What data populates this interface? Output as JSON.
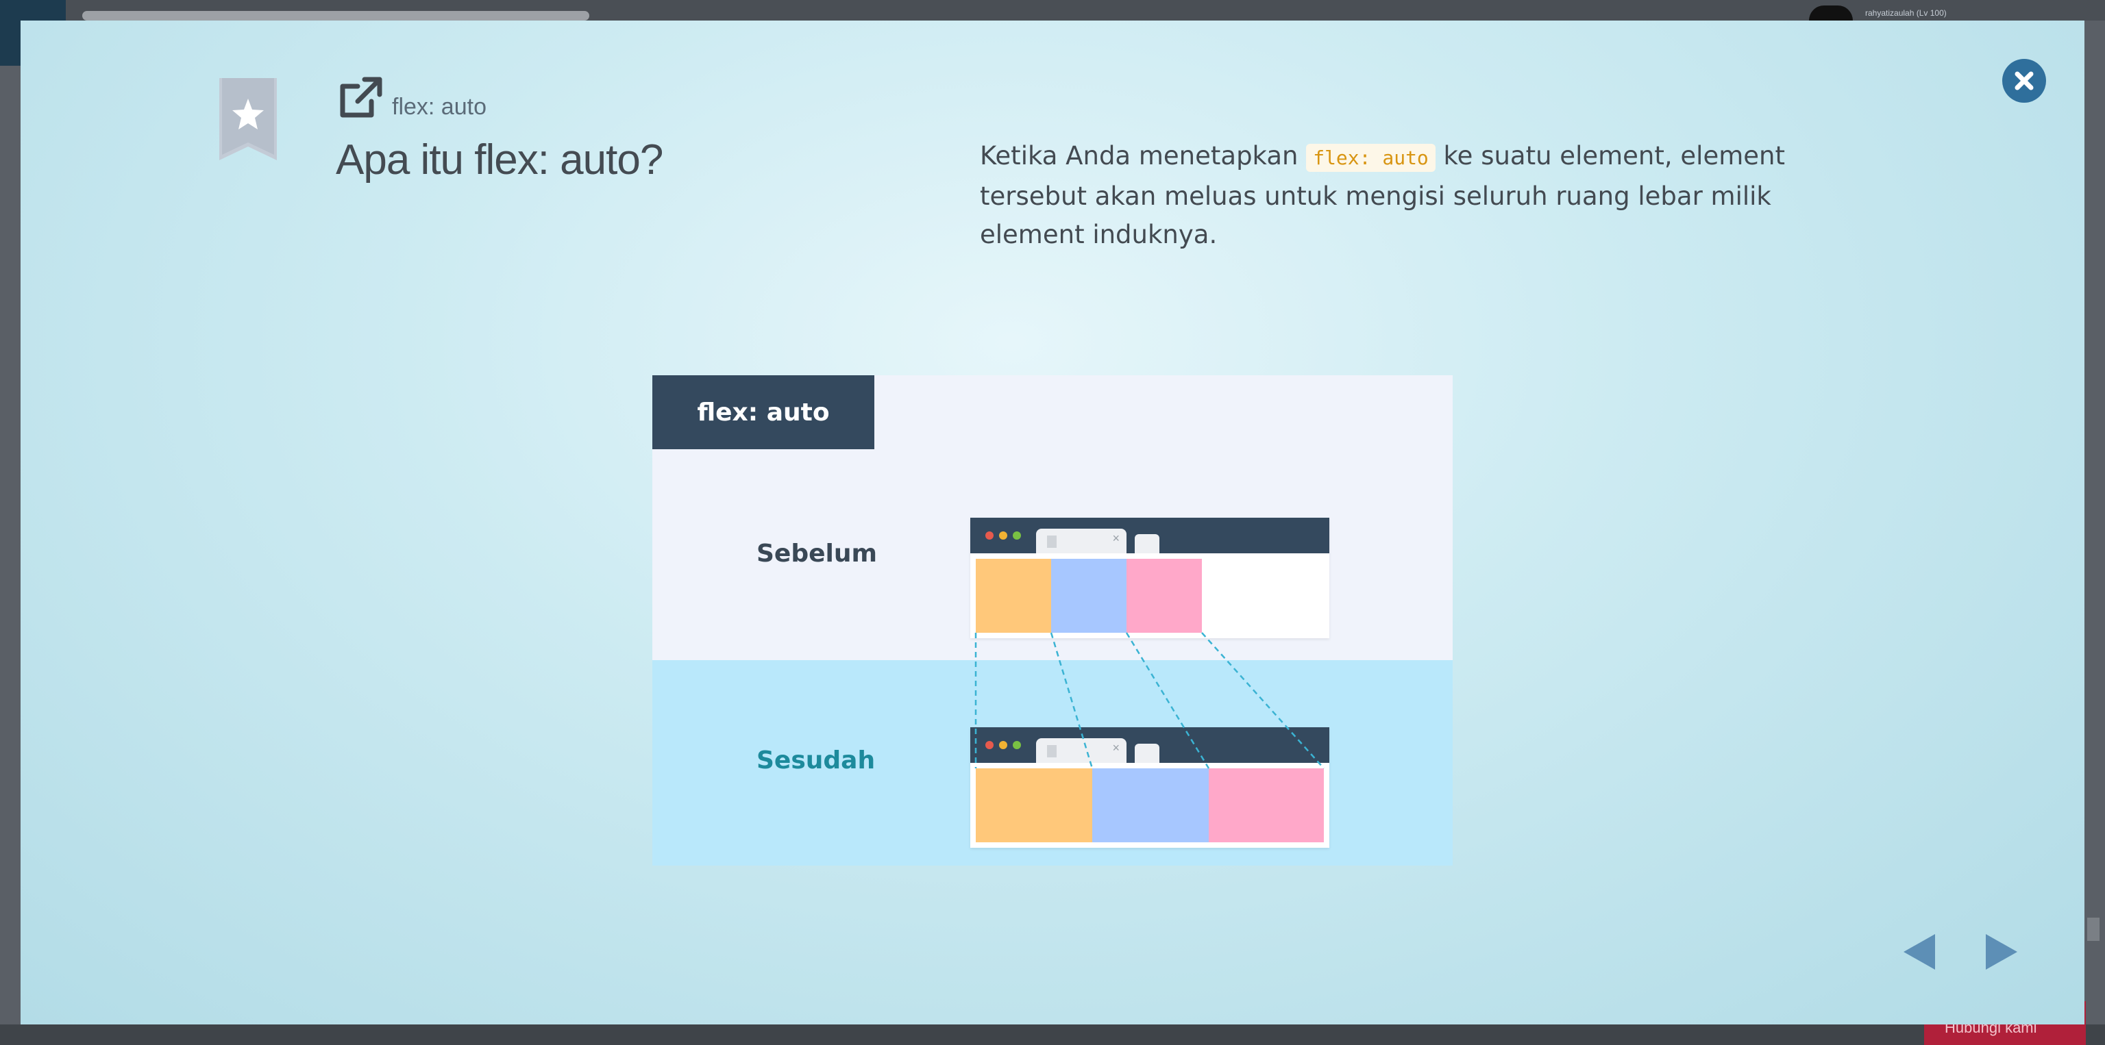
{
  "background": {
    "user_text": "rahyatizaulah (Lv 100)",
    "bottom_button_label": "Hubungi kami"
  },
  "modal": {
    "subtitle": "flex: auto",
    "title": "Apa itu flex: auto?",
    "description": {
      "before_code": "Ketika Anda menetapkan ",
      "code": "flex: auto",
      "after_code": " ke suatu element, element tersebut akan meluas untuk mengisi seluruh ruang lebar milik element induknya."
    },
    "icons": {
      "bookmark": "bookmark-star-icon",
      "external": "external-link-icon",
      "close": "close-icon",
      "prev": "arrow-left-icon",
      "next": "arrow-right-icon"
    }
  },
  "illustration": {
    "badge": "flex: auto",
    "before_label": "Sebelum",
    "after_label": "Sesudah",
    "colors": {
      "dark": "#34495e",
      "orange": "#ffc87a",
      "blue": "#a7c7ff",
      "pink": "#ffa8c9",
      "after_bg": "#b9e8fb",
      "before_bg": "#f0f3fb"
    }
  }
}
